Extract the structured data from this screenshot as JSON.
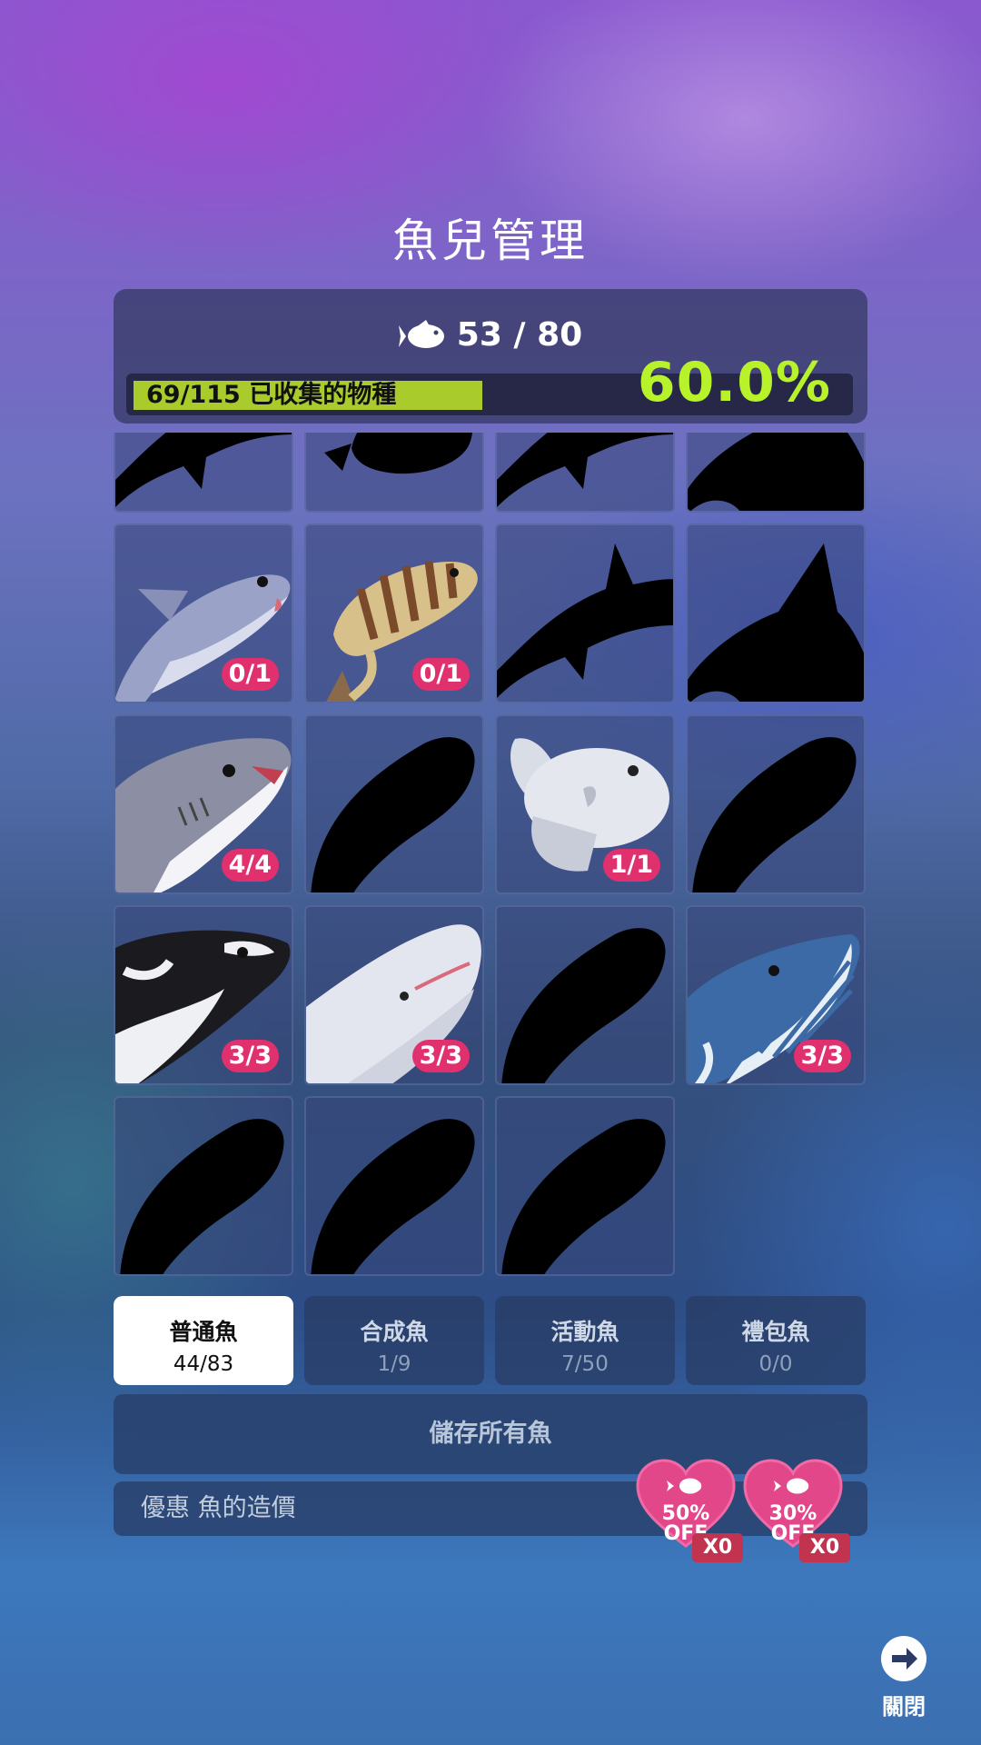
{
  "title": "魚兒管理",
  "header": {
    "count_text": "53 / 80",
    "progress_label": "69/115 已收集的物種",
    "progress_fraction": 0.6,
    "percent_text": "60.0%"
  },
  "fish_cards": [
    {
      "state": "silhouette",
      "badge": "",
      "icon": "shark-silhouette-icon"
    },
    {
      "state": "silhouette",
      "badge": "",
      "icon": "fish-silhouette-icon"
    },
    {
      "state": "silhouette",
      "badge": "",
      "icon": "shark-silhouette-icon"
    },
    {
      "state": "silhouette",
      "badge": "",
      "icon": "ray-silhouette-icon"
    },
    {
      "state": "unlocked",
      "badge": "0/1",
      "icon": "shark-icon"
    },
    {
      "state": "unlocked",
      "badge": "0/1",
      "icon": "striped-fish-icon"
    },
    {
      "state": "silhouette",
      "badge": "",
      "icon": "shark-silhouette-icon"
    },
    {
      "state": "silhouette",
      "badge": "",
      "icon": "ray-silhouette-icon"
    },
    {
      "state": "unlocked",
      "badge": "4/4",
      "icon": "great-white-shark-icon"
    },
    {
      "state": "silhouette",
      "badge": "",
      "icon": "whale-silhouette-icon"
    },
    {
      "state": "unlocked",
      "badge": "1/1",
      "icon": "sunfish-icon"
    },
    {
      "state": "silhouette",
      "badge": "",
      "icon": "whale-silhouette-icon"
    },
    {
      "state": "unlocked",
      "badge": "3/3",
      "icon": "orca-icon"
    },
    {
      "state": "unlocked",
      "badge": "3/3",
      "icon": "sperm-whale-icon"
    },
    {
      "state": "silhouette",
      "badge": "",
      "icon": "whale-silhouette-icon"
    },
    {
      "state": "unlocked",
      "badge": "3/3",
      "icon": "blue-whale-icon"
    },
    {
      "state": "silhouette",
      "badge": "",
      "icon": "whale-silhouette-icon"
    },
    {
      "state": "silhouette",
      "badge": "",
      "icon": "whale-silhouette-icon"
    },
    {
      "state": "silhouette",
      "badge": "",
      "icon": "whale-silhouette-icon"
    }
  ],
  "tabs": [
    {
      "label": "普通魚",
      "count": "44/83",
      "active": true
    },
    {
      "label": "合成魚",
      "count": "1/9",
      "active": false
    },
    {
      "label": "活動魚",
      "count": "7/50",
      "active": false
    },
    {
      "label": "禮包魚",
      "count": "0/0",
      "active": false
    }
  ],
  "save_button": "儲存所有魚",
  "discount": {
    "label": "優惠 魚的造價",
    "coupons": [
      {
        "line1": "50%",
        "line2": "OFF",
        "count": "X0",
        "color": "#e2478a"
      },
      {
        "line1": "30%",
        "line2": "OFF",
        "count": "X0",
        "color": "#e2478a"
      }
    ]
  },
  "close_button": "關閉",
  "colors": {
    "progress_fill": "#a9cc2c",
    "percent_text": "#b8f22a",
    "badge": "#e0306e"
  }
}
